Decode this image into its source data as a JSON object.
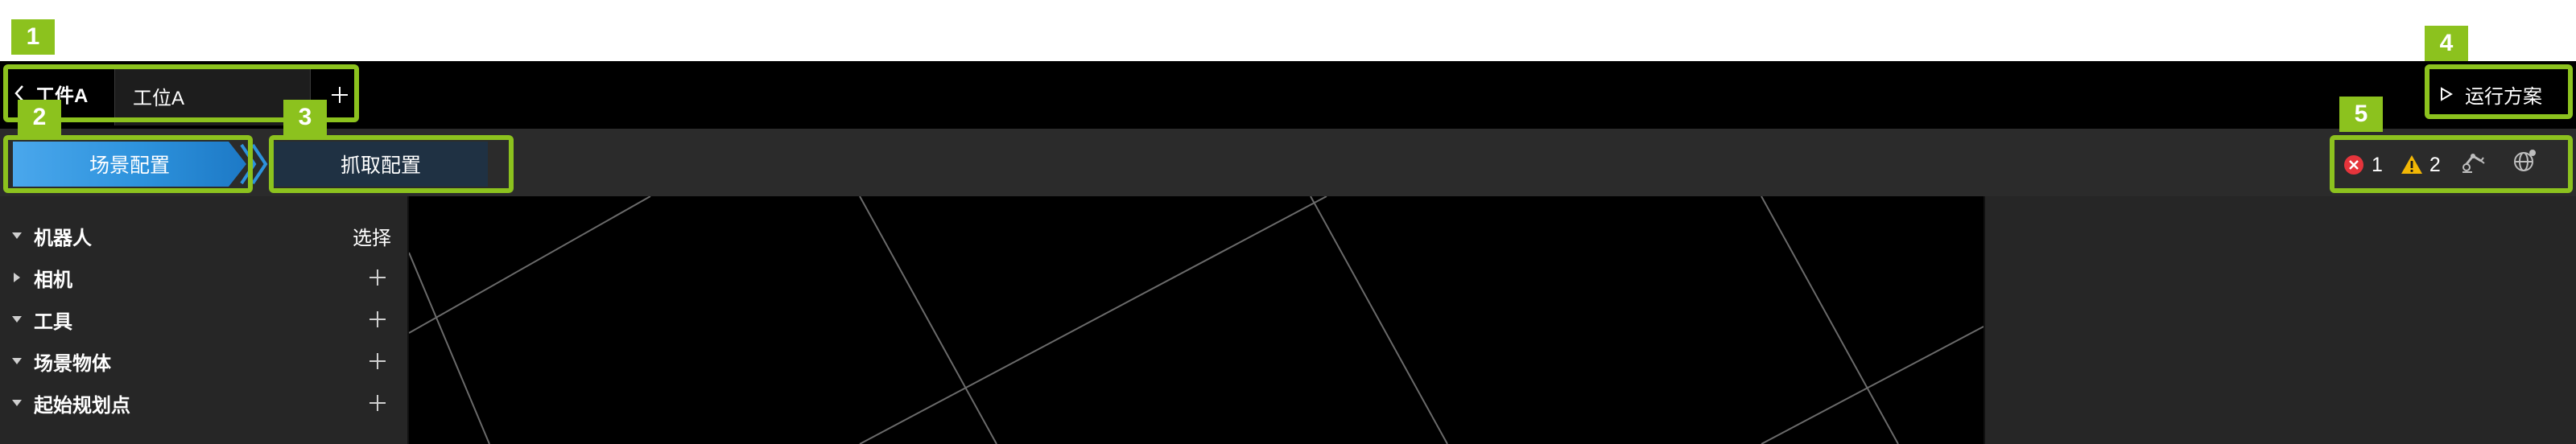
{
  "titlebar": {
    "back_label": "工件A",
    "tab_label": "工位A",
    "run_label": "运行方案"
  },
  "toolbar": {
    "step1_label": "场景配置",
    "step2_label": "抓取配置",
    "error_count": "1",
    "warning_count": "2"
  },
  "tree": {
    "items": [
      {
        "label": "机器人",
        "action": "选择",
        "expanded": true
      },
      {
        "label": "相机",
        "action": "+",
        "expanded": false
      },
      {
        "label": "工具",
        "action": "+",
        "expanded": true
      },
      {
        "label": "场景物体",
        "action": "+",
        "expanded": true
      },
      {
        "label": "起始规划点",
        "action": "+",
        "expanded": true
      }
    ]
  },
  "annotations": [
    "1",
    "2",
    "3",
    "4",
    "5"
  ],
  "colors": {
    "annotation": "#8cc21e",
    "active_step": "#2d92dc",
    "inactive_step": "#1f3143",
    "error": "#e5343b",
    "warning": "#f2b705",
    "titlebar": "#000000",
    "toolbar": "#2b2b2b",
    "panel": "#262626"
  },
  "icons": {
    "back": "chevron-left-icon",
    "add_tab": "plus-icon",
    "run": "play-outline-icon",
    "error": "error-circle-icon",
    "warning": "warning-triangle-icon",
    "tool1": "robot-arm-icon",
    "tool2": "globe-network-icon",
    "tree_caret": "caret-icon",
    "tree_add": "plus-icon"
  }
}
